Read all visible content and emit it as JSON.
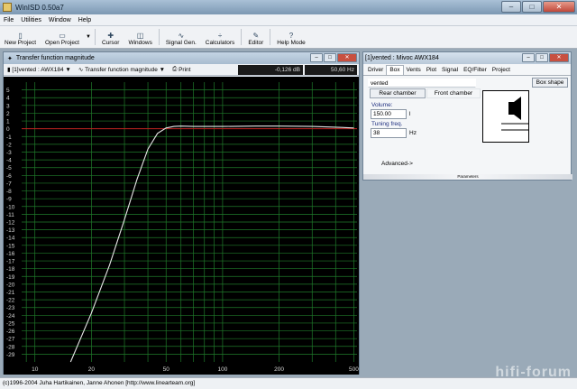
{
  "app": {
    "title": "WinISD 0.50a7"
  },
  "menu": [
    "File",
    "Utilities",
    "Window",
    "Help"
  ],
  "toolbar": [
    {
      "label": "New Project",
      "icon": "new-doc-icon"
    },
    {
      "label": "Open Project",
      "icon": "open-doc-icon"
    },
    {
      "label": "Cursor",
      "icon": "cursor-icon"
    },
    {
      "label": "Windows",
      "icon": "windows-icon"
    },
    {
      "label": "Signal Gen.",
      "icon": "signal-icon"
    },
    {
      "label": "Calculators",
      "icon": "calculator-icon"
    },
    {
      "label": "Editor",
      "icon": "editor-icon"
    },
    {
      "label": "Help Mode",
      "icon": "help-icon"
    }
  ],
  "chart_window": {
    "title": "Transfer function magnitude",
    "project_select": "[1]vented : AWX184",
    "graph_select": "Transfer function magnitude",
    "print_label": "Print",
    "readout_db": "-0,126 dB",
    "readout_hz": "50,60 Hz"
  },
  "chart_data": {
    "type": "line",
    "xlog": true,
    "xlim": [
      8.5,
      520
    ],
    "ylim": [
      -30,
      6
    ],
    "xticks": [
      10,
      20,
      50,
      100,
      200,
      500
    ],
    "xtick_labels": [
      "10",
      "20",
      "50",
      "100",
      "200",
      "500"
    ],
    "yticks": [
      5,
      4,
      3,
      2,
      1,
      0,
      -1,
      -2,
      -3,
      -4,
      -5,
      -6,
      -7,
      -8,
      -9,
      -10,
      -11,
      -12,
      -13,
      -14,
      -15,
      -16,
      -17,
      -18,
      -19,
      -20,
      -21,
      -22,
      -23,
      -24,
      -25,
      -26,
      -27,
      -28,
      -29
    ],
    "grid": true,
    "background": "#000000",
    "grid_color": "#1f7a2a",
    "reference_line": {
      "y": 0,
      "color": "#c02020"
    },
    "series": [
      {
        "color": "#e6e6e6",
        "x": [
          15.5,
          20,
          25,
          30,
          35,
          40,
          45,
          50,
          55,
          60,
          70,
          100,
          150,
          200,
          300,
          400,
          500
        ],
        "y": [
          -30,
          -23.7,
          -17.5,
          -11.7,
          -6.5,
          -2.6,
          -0.6,
          0.1,
          0.3,
          0.35,
          0.3,
          0.3,
          0.35,
          0.35,
          0.3,
          0.2,
          0.1
        ]
      }
    ]
  },
  "param_window": {
    "title": "[1]vented : Mivoc AWX184",
    "tabs": [
      "Driver",
      "Box",
      "Vents",
      "Plot",
      "Signal",
      "EQ/Filter",
      "Project"
    ],
    "active_tab": "Box",
    "box_name": "vented",
    "box_shape_label": "Box shape",
    "rear_chamber_label": "Rear chamber",
    "front_chamber_label": "Front chamber",
    "volume_label": "Volume:",
    "volume_value": "150.00",
    "volume_unit": "l",
    "tuning_label": "Tuning freq.",
    "tuning_value": "38",
    "tuning_unit": "Hz",
    "advanced_label": "Advanced->",
    "parameters_label": "Parameters"
  },
  "status": {
    "text": "(c)1996-2004 Juha Hartikainen, Janne Ahonen [http://www.linearteam.org]"
  },
  "watermark": "hifi-forum"
}
